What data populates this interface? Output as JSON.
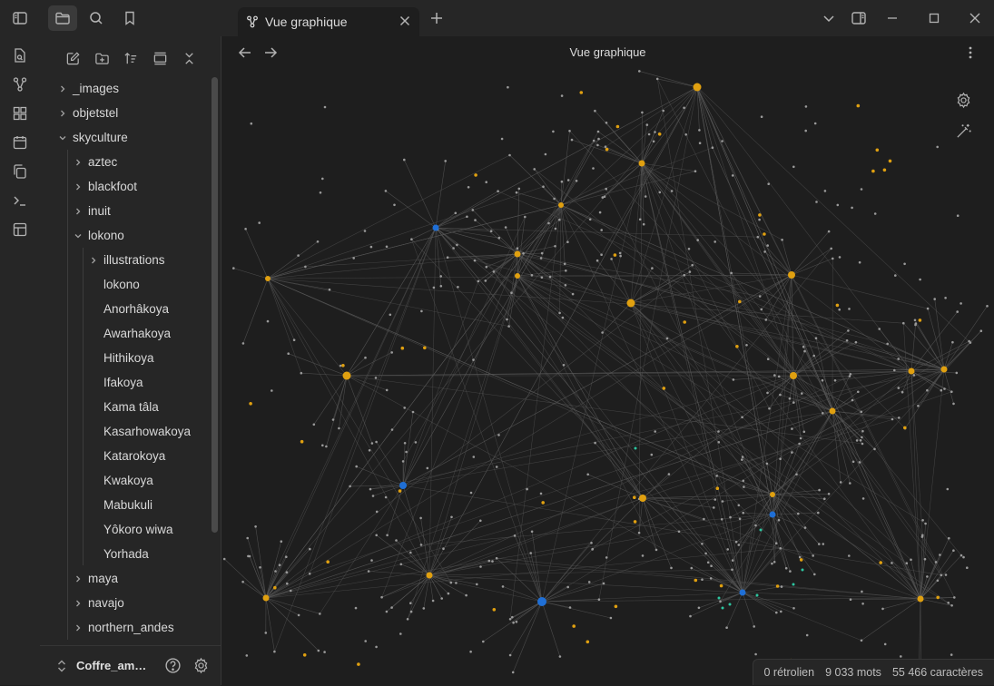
{
  "tab": {
    "title": "Vue graphique"
  },
  "view": {
    "title": "Vue graphique"
  },
  "sidebar": {
    "tree": [
      {
        "label": "_images",
        "level": 0,
        "type": "folder",
        "expanded": false
      },
      {
        "label": "objetstel",
        "level": 0,
        "type": "folder",
        "expanded": false
      },
      {
        "label": "skyculture",
        "level": 0,
        "type": "folder",
        "expanded": true
      },
      {
        "label": "aztec",
        "level": 1,
        "type": "folder",
        "expanded": false
      },
      {
        "label": "blackfoot",
        "level": 1,
        "type": "folder",
        "expanded": false
      },
      {
        "label": "inuit",
        "level": 1,
        "type": "folder",
        "expanded": false
      },
      {
        "label": "lokono",
        "level": 1,
        "type": "folder",
        "expanded": true
      },
      {
        "label": "illustrations",
        "level": 2,
        "type": "folder",
        "expanded": false
      },
      {
        "label": "lokono",
        "level": 2,
        "type": "file"
      },
      {
        "label": "Anorhâkoya",
        "level": 2,
        "type": "file"
      },
      {
        "label": "Awarhakoya",
        "level": 2,
        "type": "file"
      },
      {
        "label": "Hithikoya",
        "level": 2,
        "type": "file"
      },
      {
        "label": "Ifakoya",
        "level": 2,
        "type": "file"
      },
      {
        "label": "Kama tâla",
        "level": 2,
        "type": "file"
      },
      {
        "label": "Kasarhowakoya",
        "level": 2,
        "type": "file"
      },
      {
        "label": "Katarokoya",
        "level": 2,
        "type": "file"
      },
      {
        "label": "Kwakoya",
        "level": 2,
        "type": "file"
      },
      {
        "label": "Mabukuli",
        "level": 2,
        "type": "file"
      },
      {
        "label": "Yôkoro wiwa",
        "level": 2,
        "type": "file"
      },
      {
        "label": "Yorhada",
        "level": 2,
        "type": "file"
      },
      {
        "label": "maya",
        "level": 1,
        "type": "folder",
        "expanded": false
      },
      {
        "label": "navajo",
        "level": 1,
        "type": "folder",
        "expanded": false
      },
      {
        "label": "northern_andes",
        "level": 1,
        "type": "folder",
        "expanded": false
      }
    ]
  },
  "vault": {
    "name": "Coffre_amerindien"
  },
  "status": {
    "backlinks": "0 rétrolien",
    "words": "9 033 mots",
    "chars": "55 466 caractères"
  },
  "graph": {
    "colors": {
      "node": "#9a9a9a",
      "orange": "#e0a010",
      "blue": "#1f6fd6",
      "teal": "#2dc6a0",
      "edge": "#5a5a5a"
    }
  }
}
